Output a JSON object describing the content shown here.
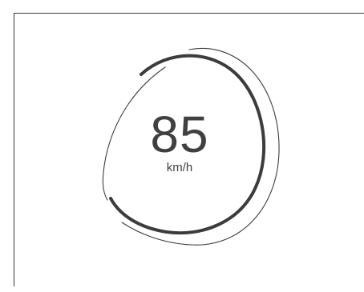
{
  "speedometer": {
    "value": "85",
    "unit": "km/h"
  },
  "colors": {
    "background": "#ffffff",
    "ring": "#3c3c3c",
    "text": "#404040",
    "border": "#3a3a3a"
  }
}
